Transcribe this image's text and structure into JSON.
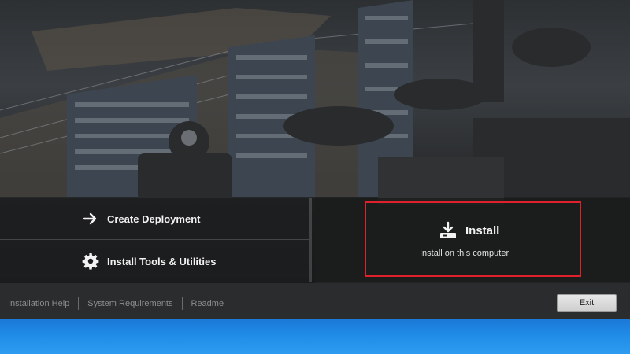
{
  "actions": {
    "create_deployment": "Create Deployment",
    "install_tools": "Install Tools & Utilities",
    "install_title": "Install",
    "install_subtitle": "Install on this computer"
  },
  "footer": {
    "links": [
      "Installation Help",
      "System Requirements",
      "Readme"
    ],
    "exit_label": "Exit"
  },
  "icons": {
    "create_deployment": "arrow-right-icon",
    "install_tools": "gear-icon",
    "install": "download-icon"
  },
  "colors": {
    "highlight": "#e0202a",
    "panel_bg": "#1c1d1e",
    "text": "#f2f2f2"
  }
}
